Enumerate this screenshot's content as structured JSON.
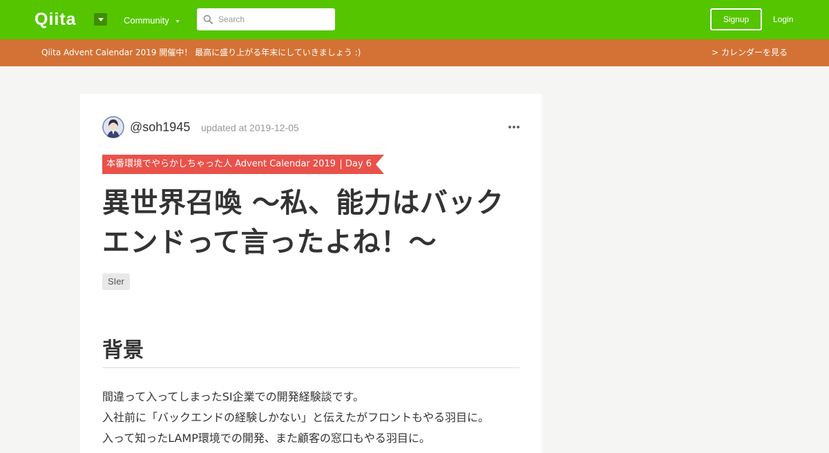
{
  "header": {
    "logo": "Qiita",
    "community_label": "Community",
    "search_placeholder": "Search",
    "signup_label": "Signup",
    "login_label": "Login"
  },
  "banner": {
    "text": "Qiita Advent Calendar 2019 開催中！ 最高に盛り上がる年末にしていきましょう :)",
    "link": "> カレンダーを見る"
  },
  "article": {
    "author": "@soh1945",
    "updated": "updated at 2019-12-05",
    "advent_calendar": "本番環境でやらかしちゃった人 Advent Calendar 2019",
    "advent_day": "Day 6",
    "title_line1": "異世界召喚 ～私、能力はバック",
    "title_line2": "エンドって言ったよね！～",
    "tags": [
      "SIer"
    ],
    "section_heading": "背景",
    "paragraph_lines": [
      "間違って入ってしまったSI企業での開発経験談です。",
      "入社前に「バックエンドの経験しかない」と伝えたがフロントもやる羽目に。",
      "入って知ったLAMP環境での開発、また顧客の窓口もやる羽目に。"
    ]
  },
  "colors": {
    "header_green": "#55c500",
    "banner_orange": "#d47235",
    "advent_red": "#e9524a"
  },
  "icons": [
    "search-icon",
    "more-icon",
    "caret-down-icon"
  ]
}
